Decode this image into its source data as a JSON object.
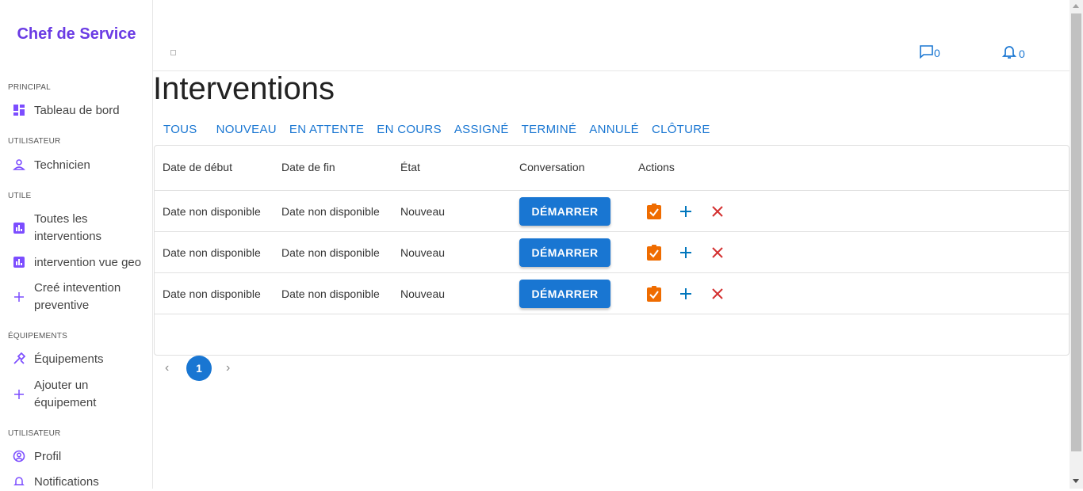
{
  "sidebar": {
    "brand": "Chef de Service",
    "sections": [
      {
        "title": "PRINCIPAL"
      },
      {
        "title": "UTILISATEUR"
      },
      {
        "title": "UTILE"
      },
      {
        "title": "ÉQUIPEMENTS"
      },
      {
        "title": "UTILISATEUR"
      }
    ],
    "items": [
      {
        "label": "Tableau de bord",
        "icon": "dashboard-icon"
      },
      {
        "label": "Technicien",
        "icon": "person-icon"
      },
      {
        "label": "Toutes les interventions",
        "icon": "bar-chart-icon"
      },
      {
        "label": "intervention vue geo",
        "icon": "bar-chart-icon"
      },
      {
        "label": "Creé intevention preventive",
        "icon": "plus-icon"
      },
      {
        "label": "Équipements",
        "icon": "tools-icon"
      },
      {
        "label": "Ajouter un équipement",
        "icon": "plus-icon"
      },
      {
        "label": "Profil",
        "icon": "account-circle-icon"
      },
      {
        "label": "Notifications",
        "icon": "bell-icon"
      }
    ]
  },
  "header": {
    "messages_count": "0",
    "notifications_count": "0"
  },
  "main": {
    "title": "Interventions",
    "tabs": [
      "TOUS",
      "NOUVEAU",
      "EN ATTENTE",
      "EN COURS",
      "ASSIGNÉ",
      "TERMINÉ",
      "ANNULÉ",
      "CLÔTURE"
    ],
    "columns": [
      "Date de début",
      "Date de fin",
      "État",
      "Conversation",
      "Actions"
    ],
    "rows": [
      {
        "start": "Date non disponible",
        "end": "Date non disponible",
        "state": "Nouveau",
        "button": "DÉMARRER"
      },
      {
        "start": "Date non disponible",
        "end": "Date non disponible",
        "state": "Nouveau",
        "button": "DÉMARRER"
      },
      {
        "start": "Date non disponible",
        "end": "Date non disponible",
        "state": "Nouveau",
        "button": "DÉMARRER"
      }
    ],
    "pagination": {
      "current": "1"
    }
  },
  "colors": {
    "accent": "#1976d2",
    "brand": "#6a3be4",
    "assign": "#ef6c00",
    "add": "#0277bd",
    "delete": "#d32f2f"
  }
}
